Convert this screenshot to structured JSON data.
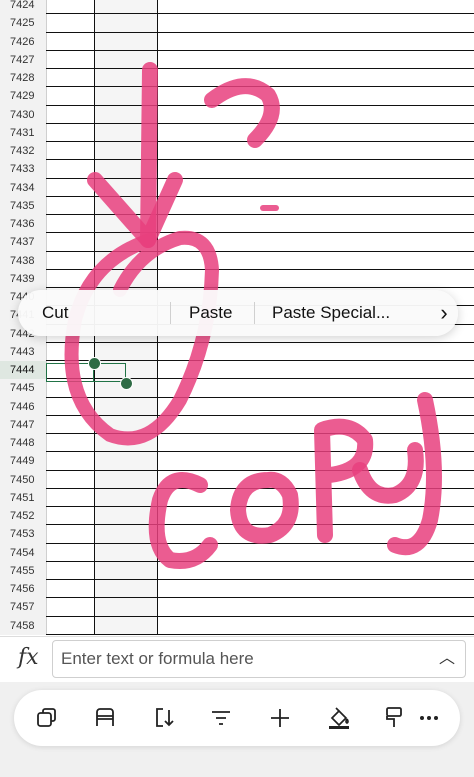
{
  "grid": {
    "row_numbers": [
      "7424",
      "7425",
      "7426",
      "7427",
      "7428",
      "7429",
      "7430",
      "7431",
      "7432",
      "7433",
      "7434",
      "7435",
      "7436",
      "7437",
      "7438",
      "7439",
      "7440",
      "7441",
      "7442",
      "7443",
      "7444",
      "7445",
      "7446",
      "7447",
      "7448",
      "7449",
      "7450",
      "7451",
      "7452",
      "7453",
      "7454",
      "7455",
      "7456",
      "7457",
      "7458"
    ],
    "selected_row": "7444"
  },
  "context_menu": {
    "cut_label": "Cut",
    "paste_label": "Paste",
    "paste_special_label": "Paste Special...",
    "more_icon": "chevron-right-icon"
  },
  "formula_bar": {
    "fx_label": "fx",
    "placeholder": "Enter text or formula here"
  },
  "toolbar": {
    "icons": [
      "copy-icon",
      "freeze-icon",
      "sort-icon",
      "filter-icon",
      "add-icon",
      "fill-color-icon",
      "format-painter-icon",
      "more-icon"
    ]
  },
  "colors": {
    "accent": "#217346",
    "ink": "#e8407e"
  }
}
